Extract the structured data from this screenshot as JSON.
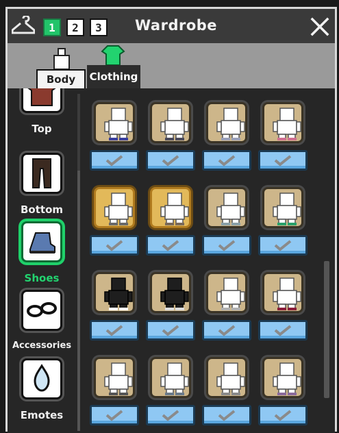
{
  "window": {
    "title": "Wardrobe",
    "presets": [
      {
        "label": "1",
        "active": true
      },
      {
        "label": "2",
        "active": false
      },
      {
        "label": "3",
        "active": false
      }
    ]
  },
  "tabs": [
    {
      "label": "Body",
      "icon": "body-icon",
      "active": false
    },
    {
      "label": "Clothing",
      "icon": "shirt-icon",
      "active": true
    }
  ],
  "categories": [
    {
      "label": "Top",
      "icon": "shirt-icon",
      "selected": false
    },
    {
      "label": "Bottom",
      "icon": "pants-icon",
      "selected": false
    },
    {
      "label": "Shoes",
      "icon": "shoe-icon",
      "selected": true
    },
    {
      "label": "Accessories",
      "icon": "glasses-icon",
      "selected": false
    },
    {
      "label": "Emotes",
      "icon": "emote-icon",
      "selected": false
    }
  ],
  "items": [
    {
      "style": "white",
      "shoe_color": "#3a3f9c"
    },
    {
      "style": "white",
      "shoe_color": "#4a4a5a"
    },
    {
      "style": "white",
      "shoe_color": "#9aa0b8"
    },
    {
      "style": "white",
      "shoe_color": "#d07090"
    },
    {
      "style": "white-gold",
      "shoe_color": "#6a6a6a"
    },
    {
      "style": "white-gold",
      "shoe_color": "#7a6a5a"
    },
    {
      "style": "white",
      "shoe_color": "#8aa0a8"
    },
    {
      "style": "white",
      "shoe_color": "#2aa06a"
    },
    {
      "style": "black",
      "shoe_color": "#ffffff"
    },
    {
      "style": "black",
      "shoe_color": "#dddddd"
    },
    {
      "style": "white",
      "shoe_color": "#b0b0b0"
    },
    {
      "style": "white",
      "shoe_color": "#8a1e3a"
    },
    {
      "style": "white",
      "shoe_color": "#555555"
    },
    {
      "style": "white",
      "shoe_color": "#6a7a8a"
    },
    {
      "style": "white",
      "shoe_color": "#8a8a8a"
    },
    {
      "style": "white",
      "shoe_color": "#8a6a9a"
    }
  ],
  "colors": {
    "accent_green": "#22c46a",
    "button_blue": "#8fc8f3",
    "slot_tan": "#cdb68a",
    "slot_gold": "#e2b95a"
  }
}
